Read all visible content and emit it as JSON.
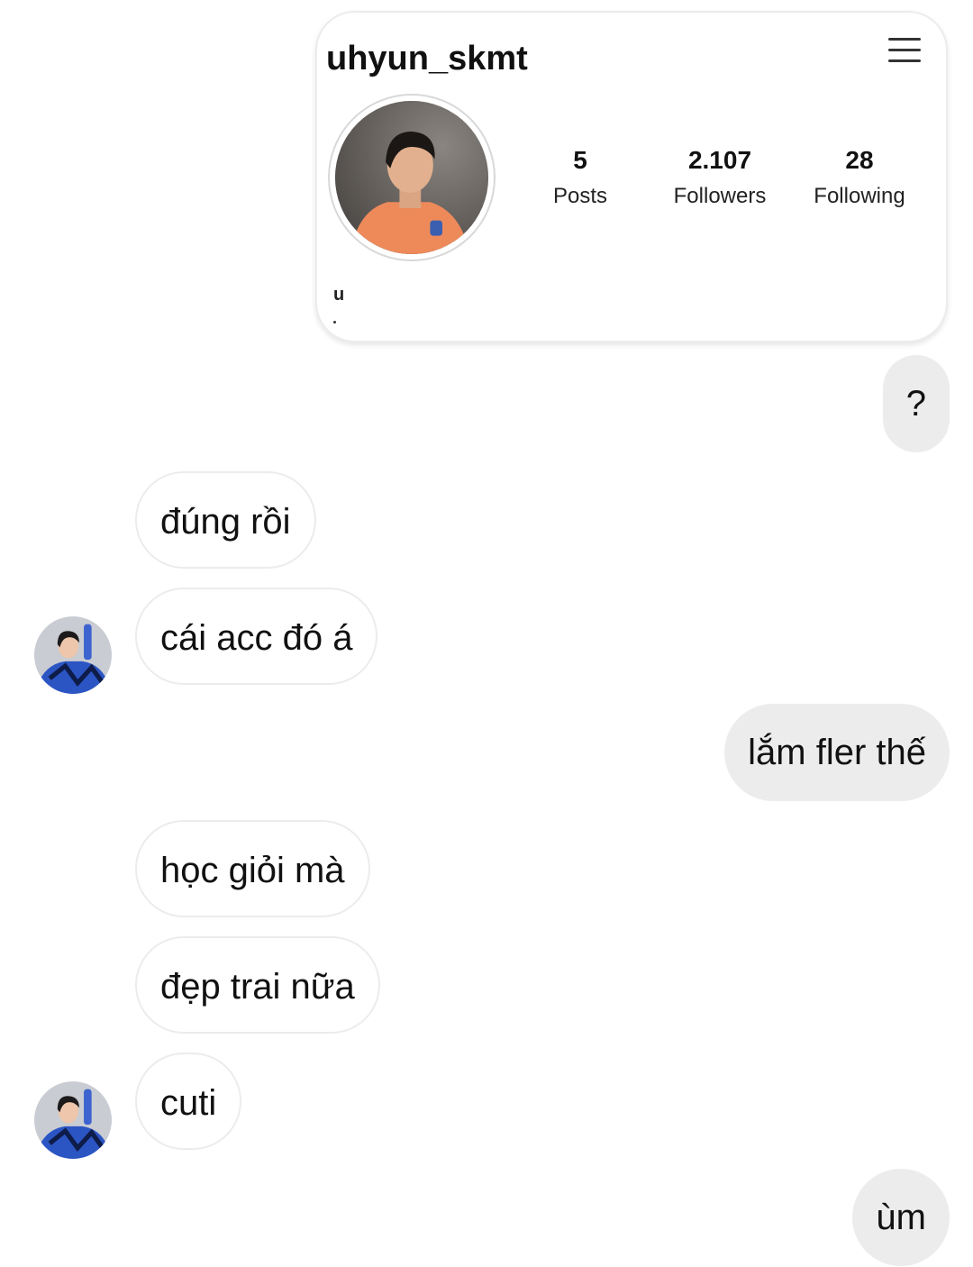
{
  "shared_profile": {
    "username": "uhyun_skmt",
    "stats": {
      "posts": {
        "value": "5",
        "label": "Posts"
      },
      "followers": {
        "value": "2.107",
        "label": "Followers"
      },
      "following": {
        "value": "28",
        "label": "Following"
      }
    },
    "bio": "u",
    "icons": {
      "menu": "hamburger-menu-icon"
    }
  },
  "messages": [
    {
      "direction": "outgoing",
      "text": "?"
    },
    {
      "direction": "incoming",
      "text": "đúng rồi"
    },
    {
      "direction": "incoming",
      "text": "cái acc đó á"
    },
    {
      "direction": "outgoing",
      "text": "lắm fler thế"
    },
    {
      "direction": "incoming",
      "text": "học giỏi mà"
    },
    {
      "direction": "incoming",
      "text": "đẹp trai nữa"
    },
    {
      "direction": "incoming",
      "text": "cuti"
    },
    {
      "direction": "outgoing",
      "text": "ùm"
    }
  ],
  "colors": {
    "outgoing_bubble": "#ececec",
    "incoming_bubble": "#ffffff",
    "text": "#111111"
  }
}
